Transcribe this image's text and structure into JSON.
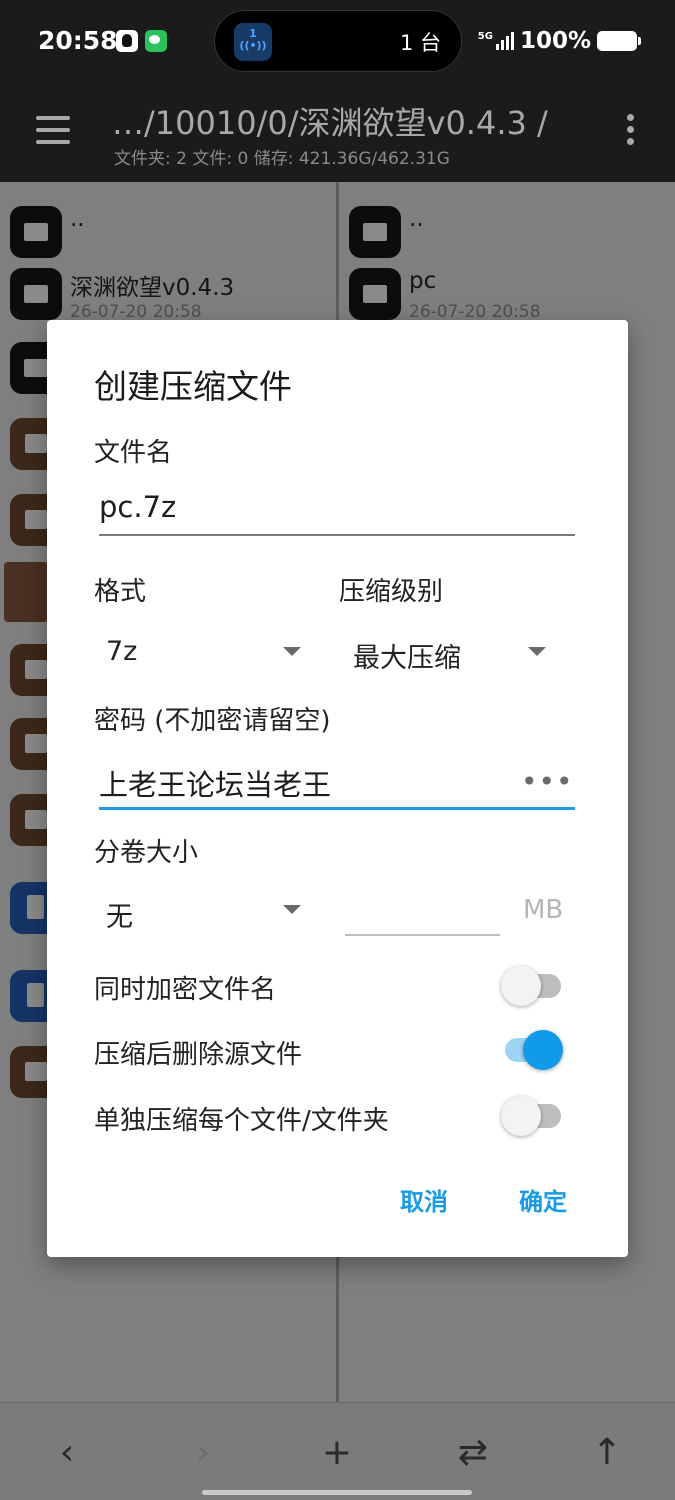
{
  "status_bar": {
    "time": "20:58",
    "app_icons": [
      "qq-icon",
      "wechat-icon"
    ],
    "island_icon_text": "1",
    "island_text": "1 台",
    "network": "5G",
    "battery": "100%"
  },
  "toolbar": {
    "path": "…/10010/0/深渊欲望v0.4.3 /",
    "summary": "文件夹: 2  文件: 0  储存: 421.36G/462.31G"
  },
  "left_pane": {
    "items": [
      {
        "name": "..",
        "date": "",
        "type": "folder"
      },
      {
        "name": "深渊欲望v0.4.3",
        "date": "26-07-20 20:58",
        "type": "folder"
      },
      {
        "name": "",
        "date": "",
        "type": "folder"
      },
      {
        "name": "",
        "date": "",
        "type": "archive"
      },
      {
        "name": "",
        "date": "",
        "type": "archive"
      },
      {
        "name": "",
        "date": "",
        "type": "image"
      },
      {
        "name": "",
        "date": "",
        "type": "archive"
      },
      {
        "name": "",
        "date": "",
        "type": "archive"
      },
      {
        "name": "",
        "date": "",
        "type": "archive"
      },
      {
        "name": "",
        "date": "",
        "type": "document"
      },
      {
        "name": "",
        "date": "",
        "type": "document"
      },
      {
        "name": "",
        "date": "",
        "type": "archive"
      }
    ]
  },
  "right_pane": {
    "items": [
      {
        "name": "..",
        "date": "",
        "type": "folder"
      },
      {
        "name": "pc",
        "date": "26-07-20 20:58",
        "type": "folder"
      }
    ]
  },
  "dialog": {
    "title": "创建压缩文件",
    "filename_label": "文件名",
    "filename_value": "pc.7z",
    "format_label": "格式",
    "format_value": "7z",
    "level_label": "压缩级别",
    "level_value": "最大压缩",
    "password_label": "密码 (不加密请留空)",
    "password_value": "上老王论坛当老王",
    "volume_label": "分卷大小",
    "volume_value": "无",
    "volume_size_value": "",
    "volume_unit": "MB",
    "encrypt_names_label": "同时加密文件名",
    "encrypt_names_on": false,
    "delete_source_label": "压缩后删除源文件",
    "delete_source_on": true,
    "separate_label": "单独压缩每个文件/文件夹",
    "separate_on": false,
    "cancel_label": "取消",
    "ok_label": "确定"
  },
  "bottom_nav": {
    "back": "‹",
    "forward": "›",
    "add": "+",
    "swap": "⇄",
    "up": "↑"
  },
  "colors": {
    "accent": "#1a9be6",
    "toolbar_bg": "#1b1b1b",
    "dim_overlay_bg": "#7f7f7f"
  }
}
